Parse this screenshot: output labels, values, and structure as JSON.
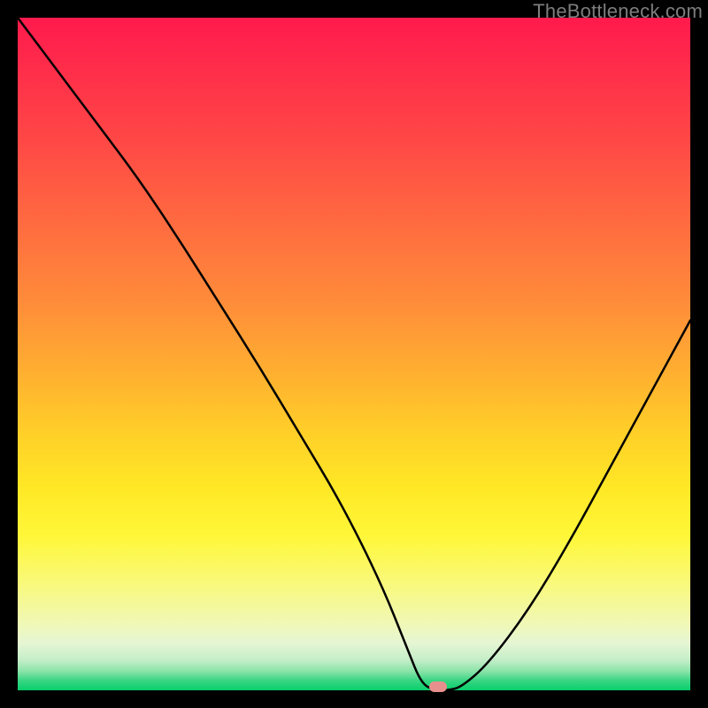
{
  "watermark": "TheBottleneck.com",
  "marker": {
    "x_pct": 62.5,
    "y_pct": 99.5,
    "color": "#e78f8c"
  },
  "chart_data": {
    "type": "line",
    "title": "",
    "xlabel": "",
    "ylabel": "",
    "xlim": [
      0,
      100
    ],
    "ylim": [
      0,
      100
    ],
    "grid": false,
    "legend": false,
    "series": [
      {
        "name": "bottleneck-curve",
        "x": [
          0,
          6,
          12,
          18,
          24,
          30,
          36,
          42,
          48,
          54,
          58,
          60,
          62,
          64,
          66,
          70,
          76,
          82,
          88,
          94,
          100
        ],
        "y": [
          100,
          92,
          84,
          76,
          67,
          57.5,
          48,
          38,
          28,
          16,
          6,
          1,
          0,
          0,
          0.5,
          4,
          12,
          22,
          33,
          44,
          55
        ]
      }
    ],
    "annotations": [
      {
        "type": "marker",
        "x": 62.5,
        "y": 0.5,
        "label": "optimal-point"
      }
    ],
    "background_gradient": {
      "top": "#ff1a4d",
      "upper_mid": "#ff8b3a",
      "mid": "#ffe826",
      "lower_mid": "#f0f8b5",
      "bottom": "#07cf6b"
    }
  }
}
